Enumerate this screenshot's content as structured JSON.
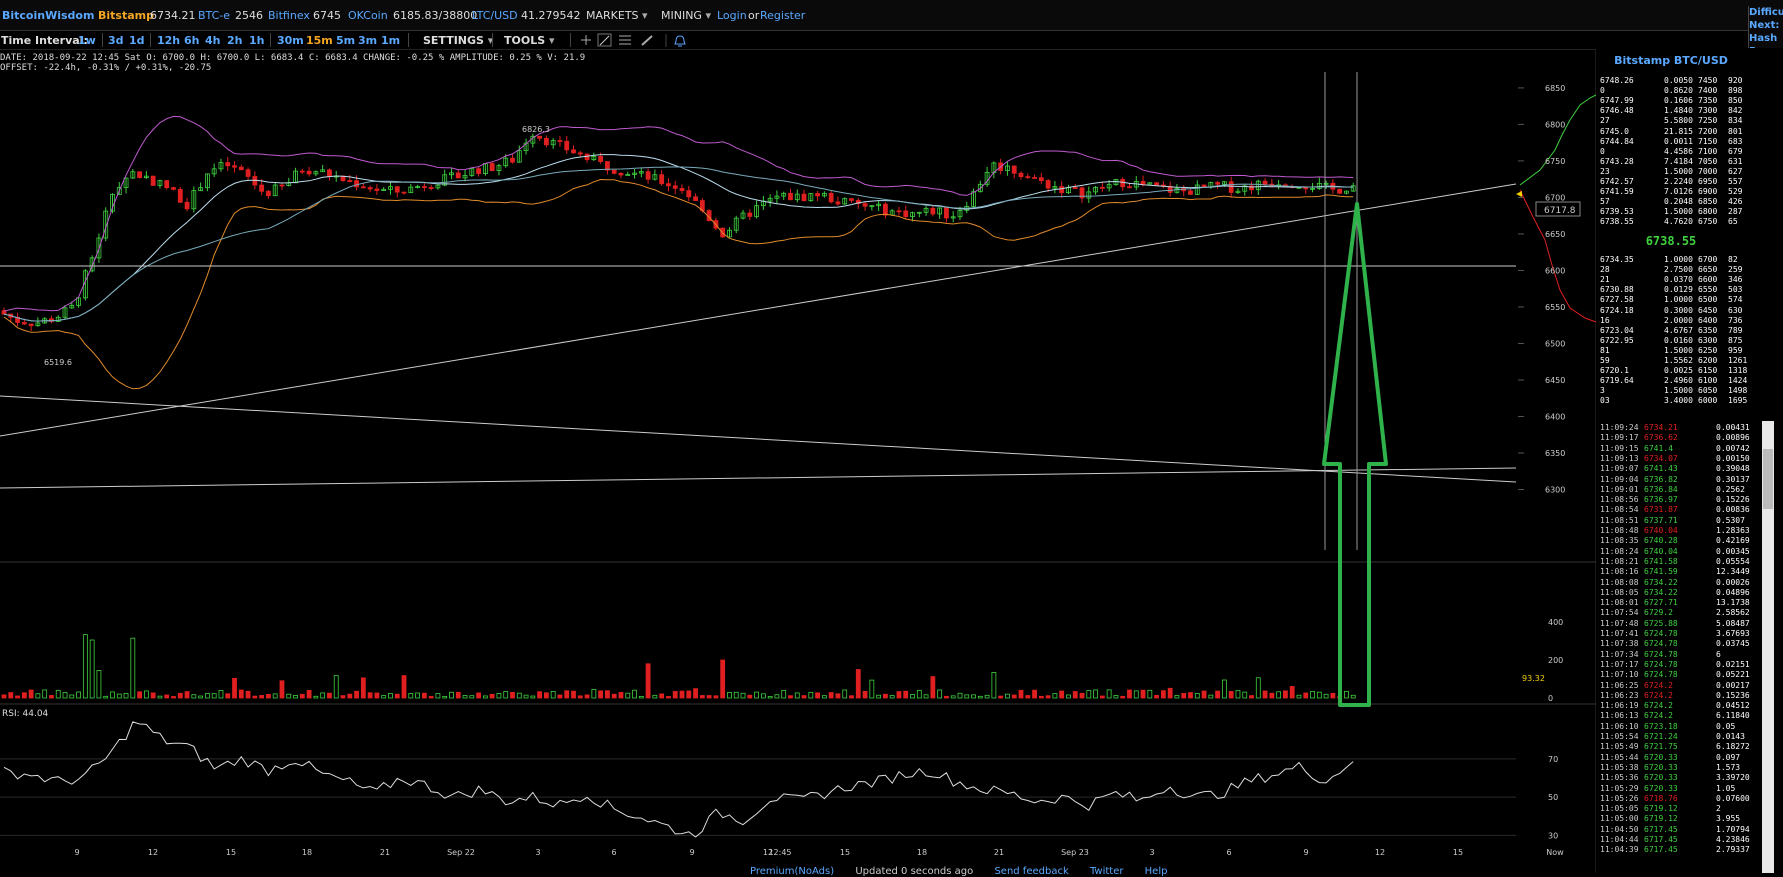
{
  "header": {
    "brand": "BitcoinWisdom",
    "tickers": [
      {
        "name": "Bitstamp",
        "value": "6734.21"
      },
      {
        "name": "BTC-e",
        "value": "2546"
      },
      {
        "name": "Bitfinex",
        "value": "6745"
      },
      {
        "name": "OKCoin",
        "value": "6185.83/38800"
      },
      {
        "name": "LTC/USD",
        "value": "41.279542"
      }
    ],
    "menus": [
      "MARKETS",
      "MINING"
    ],
    "login": "Login",
    "or": "or",
    "register": "Register",
    "right_panel": [
      "Difficu",
      "Next:",
      "Hash R"
    ]
  },
  "toolbar": {
    "label": "Time Interval:",
    "intervals": [
      "1w",
      "3d",
      "1d",
      "12h",
      "6h",
      "4h",
      "2h",
      "1h",
      "30m",
      "15m",
      "5m",
      "3m",
      "1m"
    ],
    "selected": "15m",
    "settings": "SETTINGS",
    "tools": "TOOLS",
    "icons": [
      "crosshair-icon",
      "line-tool-icon",
      "horizontal-lines-icon",
      "brush-icon",
      "bell-icon"
    ]
  },
  "info": {
    "line1": "DATE: 2018-09-22 12:45 Sat   O: 6700.0   H: 6700.0   L: 6683.4   C: 6683.4   CHANGE: -0.25 %   AMPLITUDE: 0.25 %   V: 21.9",
    "line2": "OFFSET: -22.4h, -0.31% / +0.31%, -20.75"
  },
  "chart_data": {
    "type": "candlestick",
    "price_ylim": [
      6250,
      6880
    ],
    "price_ticks": [
      6850,
      6800,
      6750,
      6700,
      6650,
      6600,
      6550,
      6500,
      6450,
      6400,
      6350,
      6300
    ],
    "volume_ticks": [
      400,
      200,
      0
    ],
    "rsi_label": "RSI: 44.04",
    "rsi_ticks": [
      70,
      50,
      30
    ],
    "x_ticks": [
      "9",
      "12",
      "15",
      "18",
      "21",
      "Sep 22",
      "3",
      "6",
      "9",
      "12",
      "15",
      "18",
      "21",
      "Sep 23",
      "3",
      "6",
      "9",
      "12",
      "15",
      "Now"
    ],
    "crosshair_time": "12:45",
    "annotations": {
      "high": "6826.3",
      "low": "6519.6",
      "last_price": "6717.8",
      "last_volume": "93.32"
    },
    "price_path": [
      6545,
      6532,
      6528,
      6535,
      6550,
      6620,
      6705,
      6735,
      6725,
      6712,
      6690,
      6735,
      6745,
      6730,
      6705,
      6715,
      6740,
      6735,
      6725,
      6718,
      6710,
      6708,
      6715,
      6722,
      6728,
      6738,
      6742,
      6752,
      6790,
      6775,
      6765,
      6752,
      6742,
      6735,
      6728,
      6720,
      6710,
      6680,
      6650,
      6672,
      6690,
      6702,
      6700,
      6705,
      6695,
      6690,
      6685,
      6680,
      6678,
      6682,
      6675,
      6700,
      6745,
      6740,
      6728,
      6718,
      6710,
      6705,
      6715,
      6722,
      6717,
      6712,
      6708,
      6712,
      6716,
      6712,
      6718,
      6722,
      6720,
      6716,
      6710,
      6716
    ],
    "rsi_path": [
      63,
      62,
      58,
      60,
      72,
      90,
      80,
      76,
      65,
      70,
      64,
      70,
      62,
      58,
      52,
      60,
      56,
      50,
      54,
      48,
      50,
      46,
      52,
      44,
      40,
      35,
      30,
      42,
      38,
      50,
      48,
      52,
      56,
      58,
      62,
      64,
      58,
      54,
      52,
      48,
      50,
      46,
      52,
      48,
      56,
      50,
      52,
      58,
      62,
      66,
      58,
      70
    ]
  },
  "orderbook": {
    "title": "Bitstamp BTC/USD",
    "mid_price": "6738.55",
    "asks": [
      [
        "6748.26",
        "0.0050",
        "7450",
        "920"
      ],
      [
        "0",
        "0.8620",
        "7400",
        "898"
      ],
      [
        "6747.99",
        "0.1606",
        "7350",
        "850"
      ],
      [
        "6746.48",
        "1.4840",
        "7300",
        "842"
      ],
      [
        "27",
        "5.5800",
        "7250",
        "834"
      ],
      [
        "6745.0",
        "21.815",
        "7200",
        "801"
      ],
      [
        "6744.84",
        "0.0011",
        "7150",
        "683"
      ],
      [
        "0",
        "4.4586",
        "7100",
        "679"
      ],
      [
        "6743.28",
        "7.4184",
        "7050",
        "631"
      ],
      [
        "23",
        "1.5000",
        "7000",
        "627"
      ],
      [
        "6742.57",
        "2.2240",
        "6950",
        "557"
      ],
      [
        "6741.59",
        "7.0126",
        "6900",
        "529"
      ],
      [
        "57",
        "0.2048",
        "6850",
        "426"
      ],
      [
        "6739.53",
        "1.5000",
        "6800",
        "287"
      ],
      [
        "6738.55",
        "4.7620",
        "6750",
        "65"
      ]
    ],
    "bids": [
      [
        "6734.35",
        "1.0000",
        "6700",
        "82"
      ],
      [
        "28",
        "2.7500",
        "6650",
        "259"
      ],
      [
        "21",
        "0.0370",
        "6600",
        "346"
      ],
      [
        "6730.88",
        "0.0129",
        "6550",
        "503"
      ],
      [
        "6727.58",
        "1.0000",
        "6500",
        "574"
      ],
      [
        "6724.18",
        "0.3000",
        "6450",
        "630"
      ],
      [
        "16",
        "2.0000",
        "6400",
        "736"
      ],
      [
        "6723.04",
        "4.6767",
        "6350",
        "789"
      ],
      [
        "6722.95",
        "0.0160",
        "6300",
        "875"
      ],
      [
        "81",
        "1.5000",
        "6250",
        "959"
      ],
      [
        "59",
        "1.5562",
        "6200",
        "1261"
      ],
      [
        "6720.1",
        "0.0025",
        "6150",
        "1318"
      ],
      [
        "6719.64",
        "2.4960",
        "6100",
        "1424"
      ],
      [
        "3",
        "1.5000",
        "6050",
        "1498"
      ],
      [
        "03",
        "3.4000",
        "6000",
        "1695"
      ]
    ]
  },
  "trades": [
    [
      "11:09:24",
      "6734.21",
      "0.00431",
      "r"
    ],
    [
      "11:09:17",
      "6736.62",
      "0.00896",
      "r"
    ],
    [
      "11:09:15",
      "6741.4",
      "0.00742",
      "g"
    ],
    [
      "11:09:13",
      "6734.07",
      "0.00150",
      "r"
    ],
    [
      "11:09:07",
      "6741.43",
      "0.39048",
      "g"
    ],
    [
      "11:09:04",
      "6736.82",
      "0.30137",
      "g"
    ],
    [
      "11:09:01",
      "6736.84",
      "0.2562",
      "g"
    ],
    [
      "11:08:56",
      "6736.97",
      "0.15226",
      "g"
    ],
    [
      "11:08:54",
      "6731.87",
      "0.00836",
      "r"
    ],
    [
      "11:08:51",
      "6737.71",
      "0.5307",
      "g"
    ],
    [
      "11:08:48",
      "6740.04",
      "1.28363",
      "r"
    ],
    [
      "11:08:35",
      "6740.28",
      "0.42169",
      "g"
    ],
    [
      "11:08:24",
      "6740.04",
      "0.00345",
      "g"
    ],
    [
      "11:08:21",
      "6741.58",
      "0.05554",
      "g"
    ],
    [
      "11:08:16",
      "6741.59",
      "12.3449",
      "g"
    ],
    [
      "11:08:08",
      "6734.22",
      "0.00026",
      "g"
    ],
    [
      "11:08:05",
      "6734.22",
      "0.04896",
      "g"
    ],
    [
      "11:08:01",
      "6727.71",
      "13.1738",
      "g"
    ],
    [
      "11:07:54",
      "6729.2",
      "2.58562",
      "g"
    ],
    [
      "11:07:48",
      "6725.88",
      "5.08487",
      "g"
    ],
    [
      "11:07:41",
      "6724.78",
      "3.67693",
      "g"
    ],
    [
      "11:07:38",
      "6724.78",
      "0.03745",
      "g"
    ],
    [
      "11:07:34",
      "6724.78",
      "6",
      "g"
    ],
    [
      "11:07:17",
      "6724.78",
      "0.02151",
      "g"
    ],
    [
      "11:07:10",
      "6724.78",
      "0.05221",
      "g"
    ],
    [
      "11:06:25",
      "6724.2",
      "0.00217",
      "r"
    ],
    [
      "11:06:23",
      "6724.2",
      "0.15236",
      "r"
    ],
    [
      "11:06:19",
      "6724.2",
      "0.04512",
      "g"
    ],
    [
      "11:06:13",
      "6724.2",
      "6.11840",
      "g"
    ],
    [
      "11:06:10",
      "6723.18",
      "0.05",
      "g"
    ],
    [
      "11:05:54",
      "6721.24",
      "0.0143",
      "g"
    ],
    [
      "11:05:49",
      "6721.75",
      "6.18272",
      "g"
    ],
    [
      "11:05:44",
      "6720.33",
      "0.097",
      "g"
    ],
    [
      "11:05:38",
      "6720.33",
      "1.573",
      "g"
    ],
    [
      "11:05:36",
      "6720.33",
      "3.39720",
      "g"
    ],
    [
      "11:05:29",
      "6720.33",
      "1.05",
      "g"
    ],
    [
      "11:05:26",
      "6718.76",
      "0.07600",
      "r"
    ],
    [
      "11:05:05",
      "6719.12",
      "2",
      "g"
    ],
    [
      "11:05:00",
      "6719.12",
      "3.955",
      "g"
    ],
    [
      "11:04:50",
      "6717.45",
      "1.70794",
      "g"
    ],
    [
      "11:04:44",
      "6717.45",
      "4.23846",
      "g"
    ],
    [
      "11:04:39",
      "6717.45",
      "2.79337",
      "g"
    ]
  ],
  "footer": {
    "links": [
      "Premium(NoAds)",
      "Updated 0 seconds ago",
      "Send feedback",
      "Twitter",
      "Help"
    ]
  },
  "colors": {
    "up": "#3ed13e",
    "down": "#e02020",
    "accent": "#5aa8ff",
    "highlight": "#f5a623",
    "arrow": "#2fb24a"
  }
}
